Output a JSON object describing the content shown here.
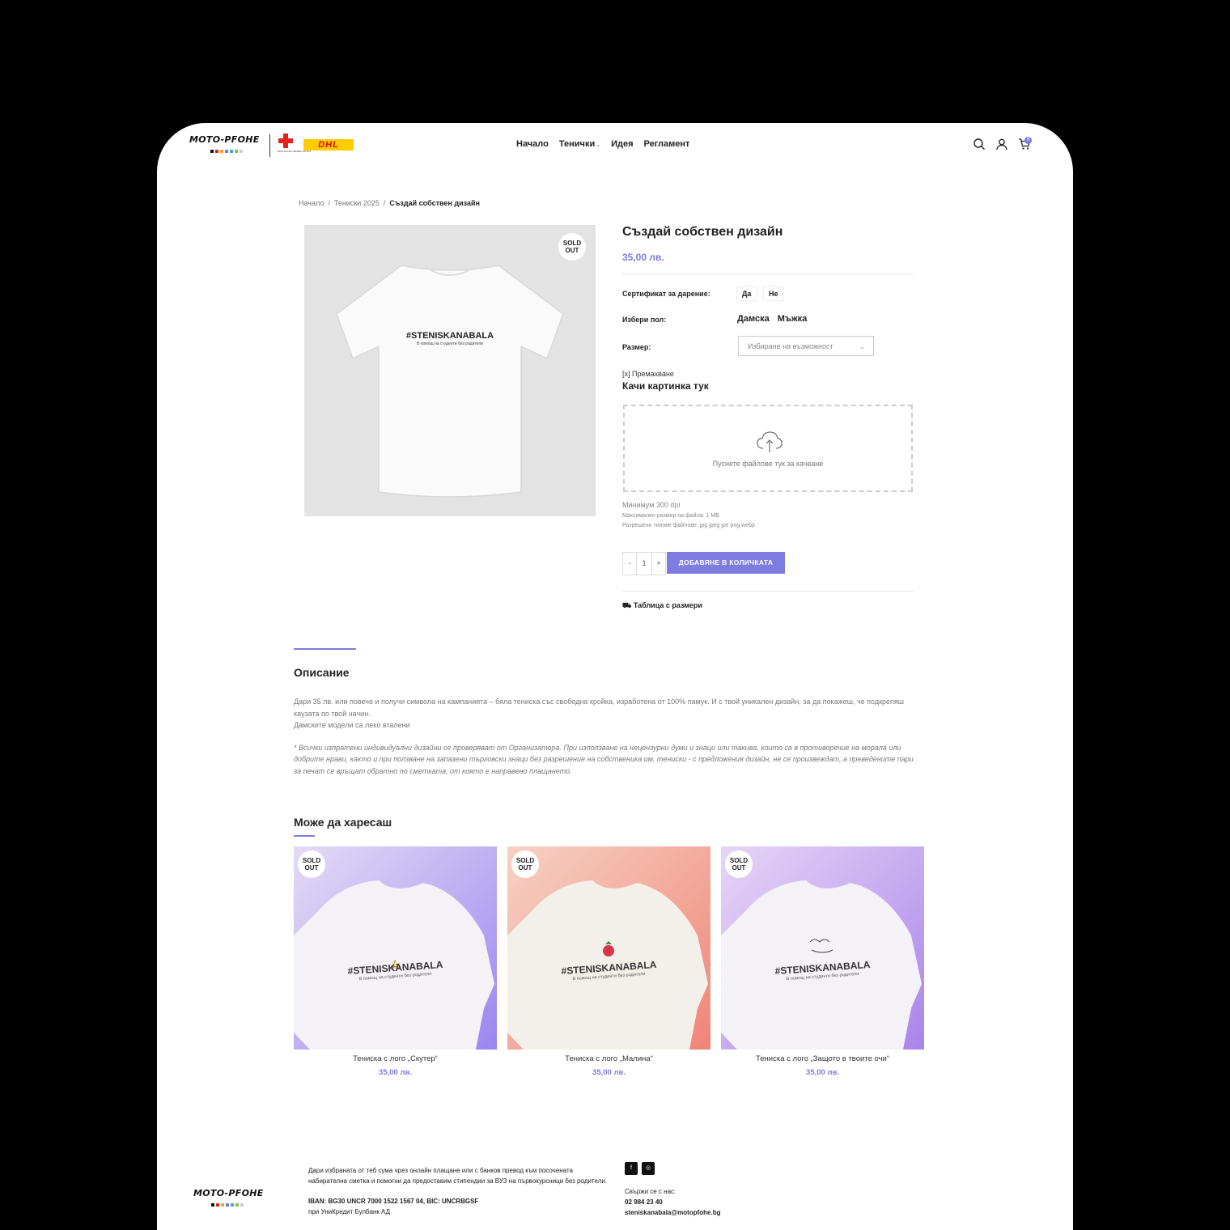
{
  "header": {
    "logo_text": "MOTO-PFOHE",
    "partner_caption": "БЪЛГАРСКИ ЧЕРВЕН КРЪСТ",
    "dhl": "DHL",
    "nav": [
      "Начало",
      "Тенички",
      "Идея",
      "Регламент"
    ],
    "cart_count": "0",
    "accent_color": "#7e7ce0"
  },
  "breadcrumb": [
    "Начало",
    "Тениски 2025",
    "Създай собствен дизайн"
  ],
  "product": {
    "badge": [
      "SOLD",
      "OUT"
    ],
    "shirt_print": "#STENISKANABALA",
    "shirt_sub": "В помощ на студенти без родители",
    "title": "Създай собствен дизайн",
    "price": "35,00 лв.",
    "cert_label": "Сертификат за дарение:",
    "cert_options": [
      "Да",
      "Не"
    ],
    "gender_label": "Избери пол:",
    "gender_options": [
      "Дамска",
      "Мъжка"
    ],
    "size_label": "Размер:",
    "size_placeholder": "Избиране на възможност",
    "remove": "[x] Премахване",
    "upload_title": "Качи картинка тук",
    "dropzone_text": "Пуснете файлове тук за качване",
    "hint_dpi": "Минимум 300 dpi",
    "hint_size": "Максимален размер на файла: 1 MB",
    "hint_types": "Разрешени типове файлове: jpg jpeg jpe png webp",
    "qty_minus": "-",
    "qty_value": "1",
    "qty_plus": "+",
    "add_to_cart": "ДОБАВЯНЕ В КОЛИЧКАТА",
    "size_table": "Таблица с размери"
  },
  "description": {
    "title": "Описание",
    "p1": "Дари 35 лв. или повече и получи символа на кампанията – бяла тениска със свободна кройка, изработена от 100% памук. И с твой уникален дизайн, за да покажеш, че подкрепяш каузата по твой начин.",
    "p2": "Дамските модели са леко вталени",
    "note": "* Всички изпратени индивидуални дизайни се проверяват от Организатора. При използване на нецензурни думи и знаци или такива, които са в противоречие на морала или добрите нрави, както и при ползване на запазени търговски знаци без разрешение на собственика им, тениски - с предложения дизайн, не се произвеждат, а преведените пари за печат се връщат обратно по сметката, от която е направено плащането."
  },
  "related": {
    "title": "Може да харесаш",
    "items": [
      {
        "name": "Тениска с лого „Скутер“",
        "price": "35,00 лв.",
        "badge": [
          "SOLD",
          "OUT"
        ],
        "print": "#STENISKANABALA",
        "sub": "В помощ на студенти без родители",
        "bg1": "#e4dcf5",
        "bg2": "#9a86f0"
      },
      {
        "name": "Тениска с лого „Малина“",
        "price": "35,00 лв.",
        "badge": [
          "SOLD",
          "OUT"
        ],
        "print": "#STENISKANABALA",
        "sub": "В помощ на студенти без родители",
        "bg1": "#f6d2c4",
        "bg2": "#f08478"
      },
      {
        "name": "Тениска с лого „Защото в твоите очи“",
        "price": "35,00 лв.",
        "badge": [
          "SOLD",
          "OUT"
        ],
        "print": "#STENISKANABALA",
        "sub": "В помощ на студенти без родители",
        "bg1": "#e7d6f6",
        "bg2": "#a884ea"
      }
    ]
  },
  "footer": {
    "logo_text": "MOTO-PFOHE",
    "text": "Дари избраната от теб сума чрез онлайн плащане или с банков превод към посочената набирателна сметка и помогни да предоставим стипендии за ВУЗ на първокурсници без родители.",
    "bank": "IBAN: BG30 UNCR 7000 1522 1567 04, BIC: UNCRBGSF",
    "bank_name": "при УниКредит Булбанк АД",
    "contact_label": "Свържи се с нас:",
    "phone": "02 984 23 40",
    "email": "steniskanabala@motopfohe.bg"
  }
}
